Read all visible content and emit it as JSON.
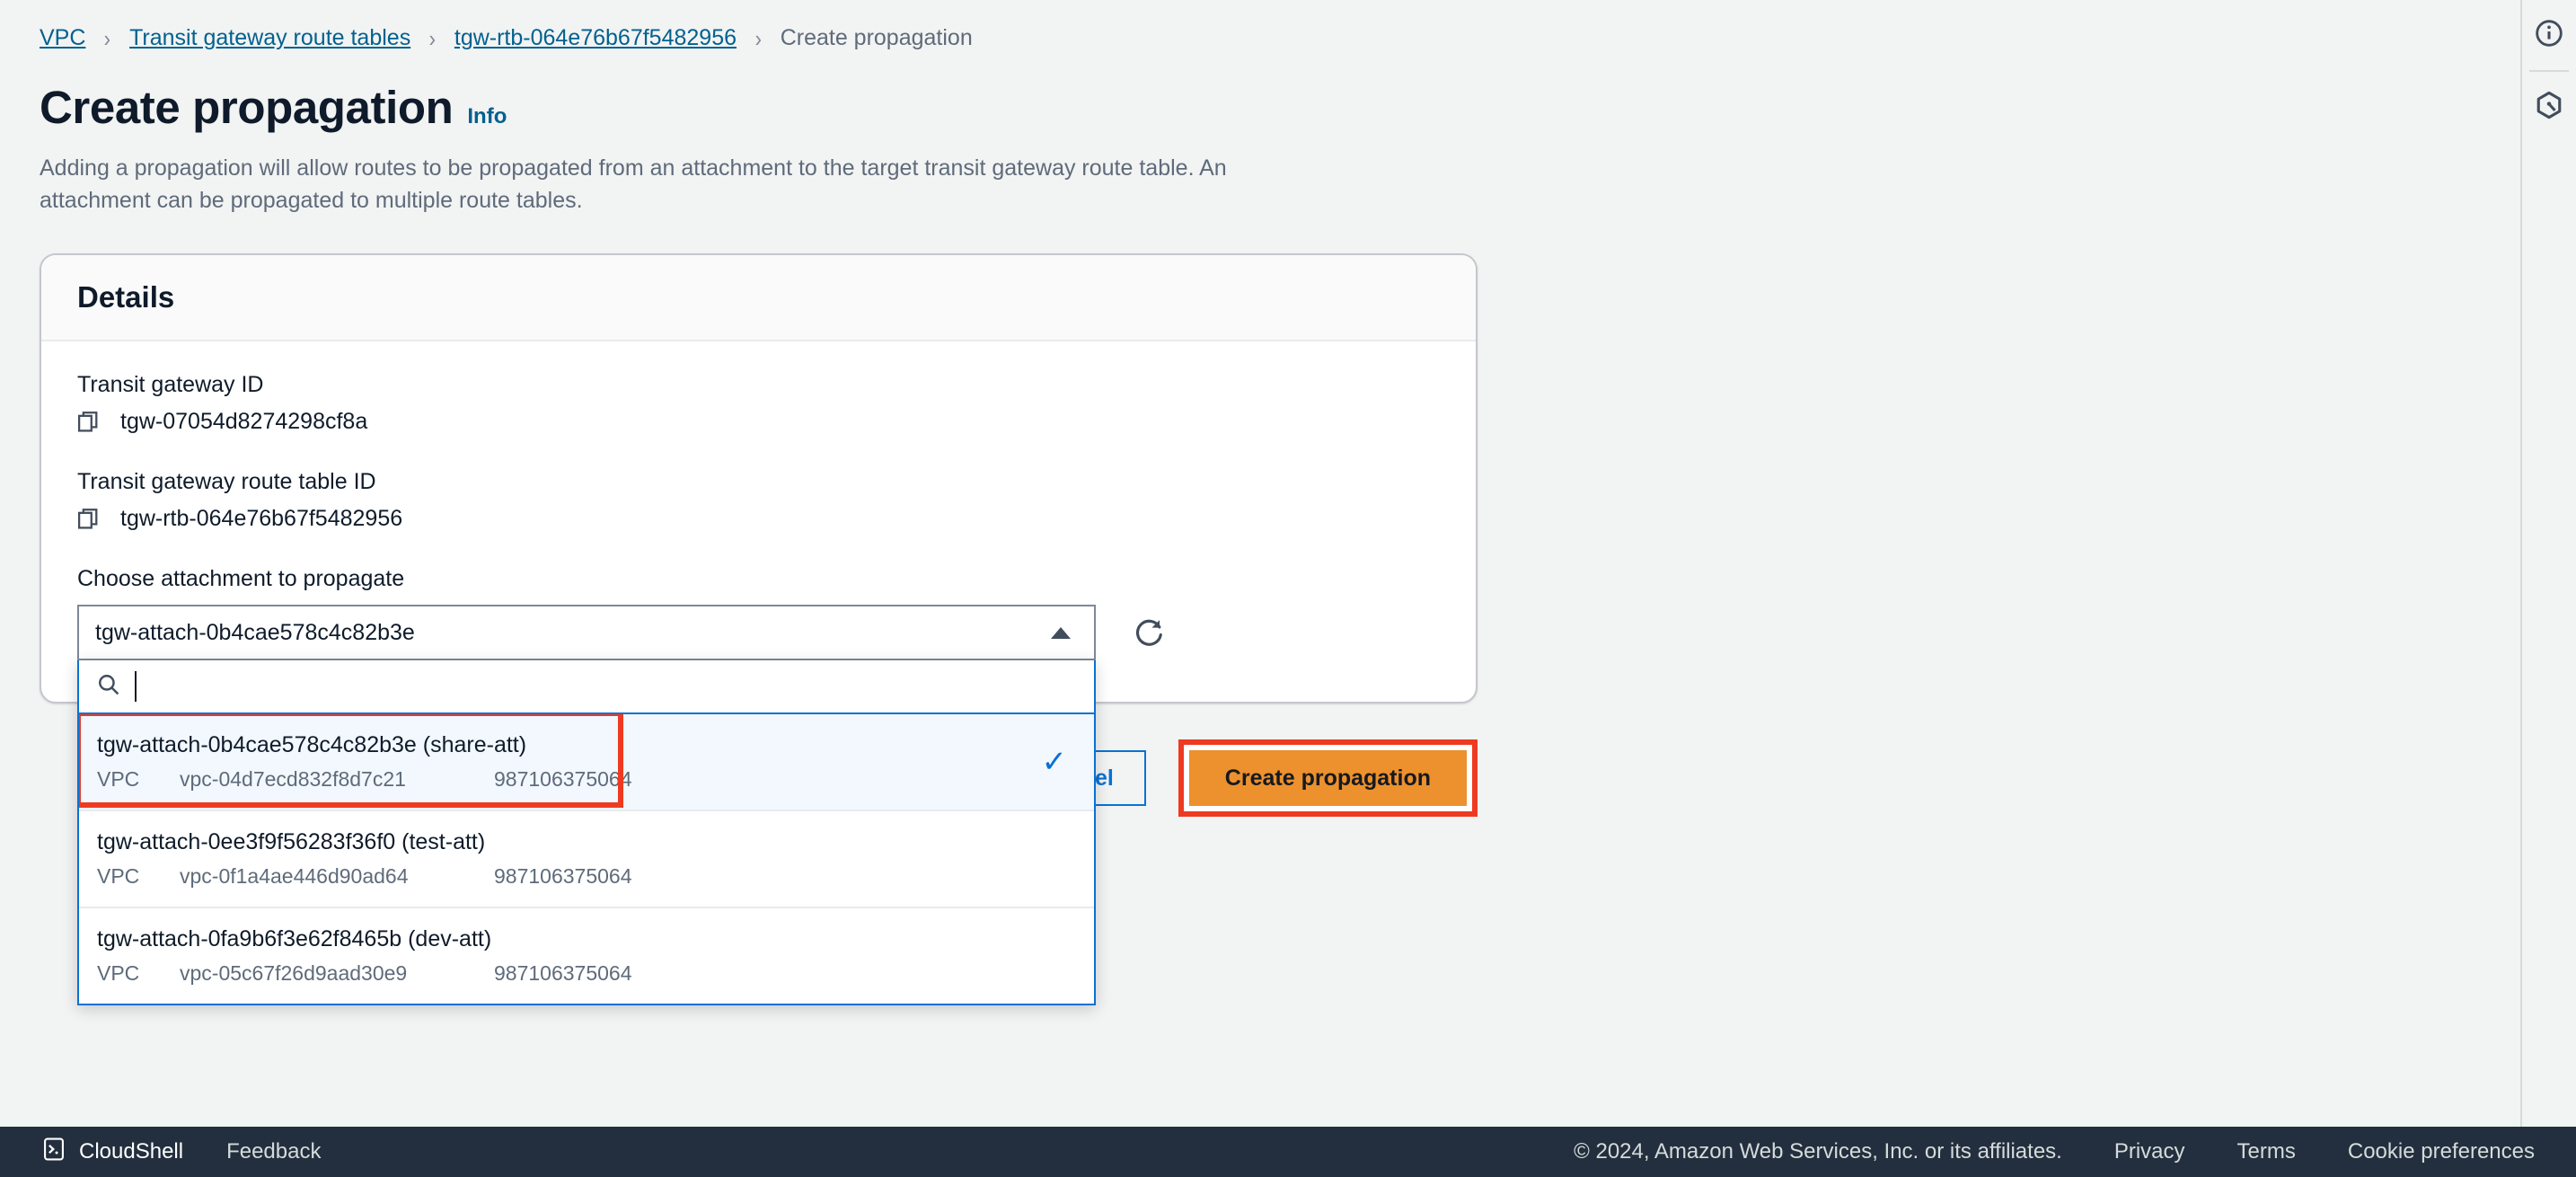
{
  "breadcrumb": {
    "items": [
      {
        "label": "VPC",
        "type": "link"
      },
      {
        "label": "Transit gateway route tables",
        "type": "link"
      },
      {
        "label": "tgw-rtb-064e76b67f5482956",
        "type": "link"
      },
      {
        "label": "Create propagation",
        "type": "current"
      }
    ],
    "separator": "›"
  },
  "header": {
    "title": "Create propagation",
    "info_label": "Info",
    "description": "Adding a propagation will allow routes to be propagated from an attachment to the target transit gateway route table. An attachment can be propagated to multiple route tables."
  },
  "details": {
    "panel_title": "Details",
    "fields": [
      {
        "label": "Transit gateway ID",
        "value": "tgw-07054d8274298cf8a",
        "copy_icon": "copy-icon"
      },
      {
        "label": "Transit gateway route table ID",
        "value": "tgw-rtb-064e76b67f5482956",
        "copy_icon": "copy-icon"
      }
    ],
    "select": {
      "label": "Choose attachment to propagate",
      "value": "tgw-attach-0b4cae578c4c82b3e",
      "expanded": true,
      "caret_icon": "caret-up-icon",
      "refresh_icon": "refresh-icon",
      "search": {
        "icon": "search-icon",
        "value": "",
        "placeholder": ""
      },
      "options": [
        {
          "title": "tgw-attach-0b4cae578c4c82b3e (share-att)",
          "resource_type": "VPC",
          "resource_id": "vpc-04d7ecd832f8d7c21",
          "account_id": "987106375064",
          "selected": true
        },
        {
          "title": "tgw-attach-0ee3f9f56283f36f0 (test-att)",
          "resource_type": "VPC",
          "resource_id": "vpc-0f1a4ae446d90ad64",
          "account_id": "987106375064",
          "selected": false
        },
        {
          "title": "tgw-attach-0fa9b6f3e62f8465b (dev-att)",
          "resource_type": "VPC",
          "resource_id": "vpc-05c67f26d9aad30e9",
          "account_id": "987106375064",
          "selected": false
        }
      ]
    }
  },
  "actions": {
    "cancel_label": "Cancel",
    "submit_label": "Create propagation"
  },
  "right_rail": {
    "items": [
      {
        "icon": "info-circle-icon",
        "name": "info-panel-toggle"
      },
      {
        "icon": "aws-q-hexagon-icon",
        "name": "amazon-q-toggle"
      }
    ]
  },
  "footer": {
    "cloudshell_label": "CloudShell",
    "feedback_label": "Feedback",
    "copyright": "© 2024, Amazon Web Services, Inc. or its affiliates.",
    "privacy_label": "Privacy",
    "terms_label": "Terms",
    "cookie_label": "Cookie preferences"
  },
  "colors": {
    "accent_link": "#00618f",
    "primary_button": "#ec912d",
    "focus_border": "#0972d3",
    "annotation": "#ee3a21",
    "footer_bg": "#232f3e"
  }
}
